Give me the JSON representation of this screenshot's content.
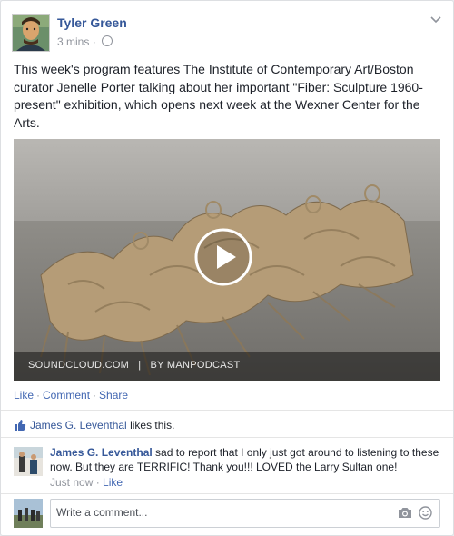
{
  "post": {
    "author": "Tyler Green",
    "time": "3 mins",
    "dot": "·",
    "text": "This week's program features The Institute of Contemporary Art/Boston curator Jenelle Porter talking about her important \"Fiber: Sculpture 1960-present\" exhibition, which opens next week at the Wexner Center for the Arts.",
    "media_caption": "SOUNDCLOUD.COM   |   BY MANPODCAST"
  },
  "actions": {
    "like": "Like",
    "comment": "Comment",
    "share": "Share",
    "sep": "·"
  },
  "likes": {
    "name": "James G. Leventhal",
    "suffix": " likes this."
  },
  "comment": {
    "author": "James G. Leventhal",
    "text": " sad to report that I only just got around to listening to these now. But they are TERRIFIC! Thank you!!! LOVED the Larry Sultan one!",
    "time": "Just now",
    "like": "Like",
    "sep": "·"
  },
  "reply": {
    "placeholder": "Write a comment..."
  },
  "colors": {
    "link": "#365899",
    "accent": "#4267b2",
    "muted": "#90949c",
    "text": "#1d2129"
  },
  "icons": [
    "avatar-painting",
    "globe-icon",
    "chevron-down-icon",
    "play-icon",
    "thumbs-up-icon",
    "camera-icon",
    "smiley-icon"
  ]
}
